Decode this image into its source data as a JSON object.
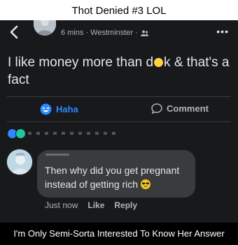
{
  "captions": {
    "top": "Thot Denied #3  LOL",
    "bottom": "I'm Only Semi-Sorta Interested To Know Her Answer"
  },
  "post": {
    "meta": "6 mins · Westminster ·",
    "text_before": "I like money more than d",
    "text_after": "k & that's a fact",
    "audience_icon": "friends-icon"
  },
  "actions": {
    "haha_label": "Haha",
    "comment_label": "Comment"
  },
  "comment": {
    "text": "Then why did you get pregnant instead of getting rich",
    "time": "Just now",
    "like_label": "Like",
    "reply_label": "Reply"
  },
  "colors": {
    "accent": "#2d88ff",
    "card_bg": "#18191b",
    "bubble_bg": "#3a3b3c",
    "muted_text": "#b0b3b8"
  }
}
